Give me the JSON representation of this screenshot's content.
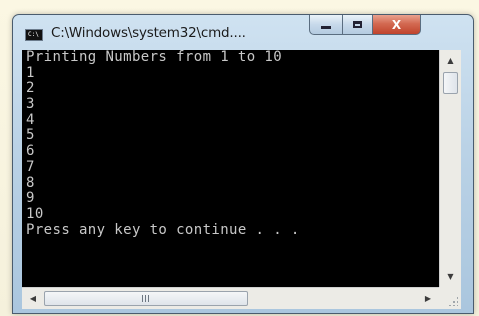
{
  "window": {
    "title": "C:\\Windows\\system32\\cmd....",
    "icon": "console-app-icon"
  },
  "caption_buttons": {
    "minimize_icon": "minimize-icon",
    "maximize_icon": "maximize-icon",
    "close_label": "X"
  },
  "console": {
    "lines": [
      "Printing Numbers from 1 to 10",
      "1",
      "2",
      "3",
      "4",
      "5",
      "6",
      "7",
      "8",
      "9",
      "10",
      "Press any key to continue . . ."
    ],
    "background": "#000000",
    "foreground": "#c8c8c8"
  },
  "scrollbars": {
    "up_arrow": "▲",
    "down_arrow": "▼",
    "left_arrow": "◀",
    "right_arrow": "▶"
  }
}
